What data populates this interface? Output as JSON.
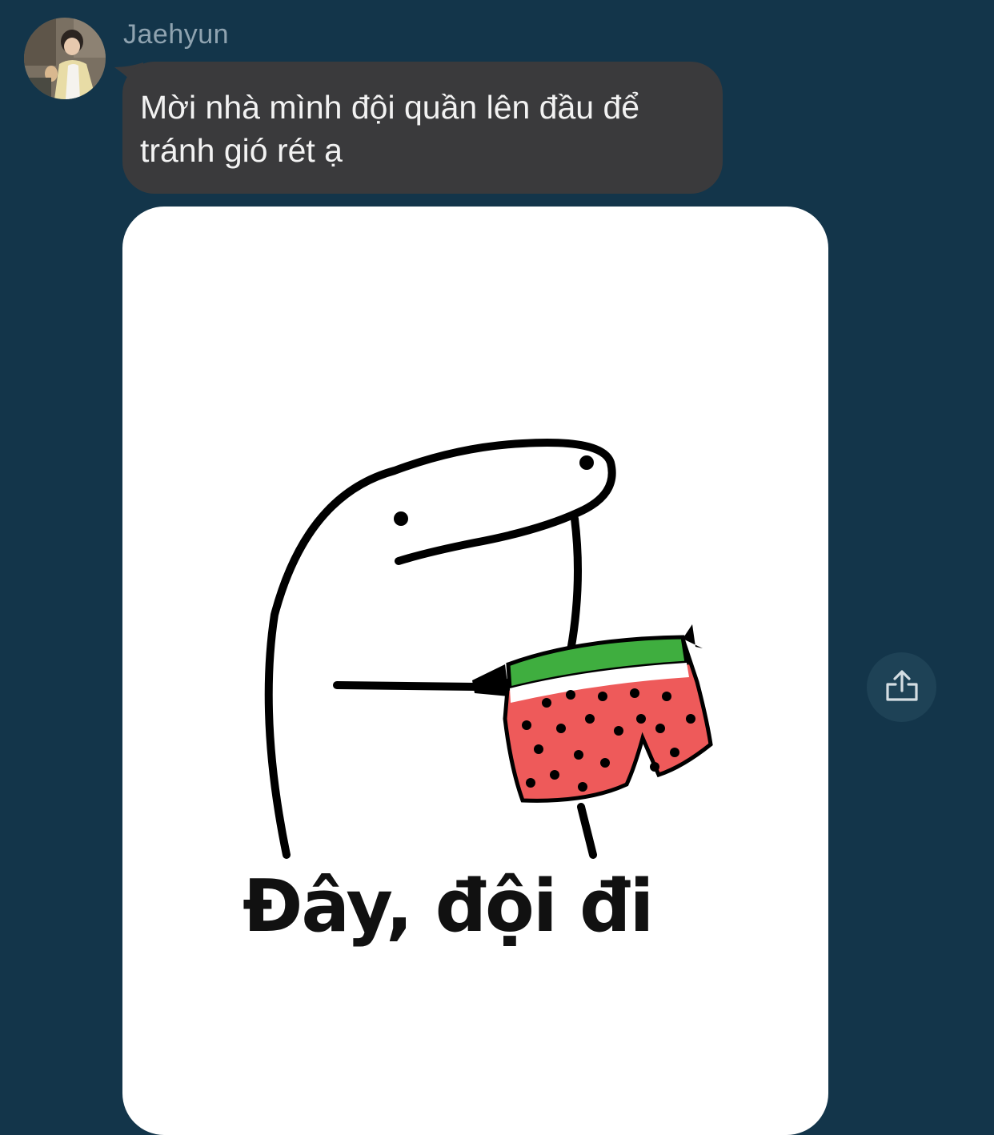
{
  "message": {
    "sender_name": "Jaehyun",
    "text": "Mời nhà mình đội quần lên đầu để tránh gió rét ạ",
    "avatar_icon": "user-avatar-photo"
  },
  "sticker": {
    "caption": "Đây, đội đi",
    "icon": "blob-character-holding-watermelon-shorts"
  },
  "actions": {
    "share_icon": "share-icon"
  },
  "colors": {
    "background": "#13354a",
    "bubble": "#3a3a3c",
    "bubble_text": "#f2f2f2",
    "sender_name": "#8fa3b0",
    "share_button": "#1e4256",
    "shorts_red": "#ee5a5a",
    "shorts_green": "#3fae3f"
  }
}
